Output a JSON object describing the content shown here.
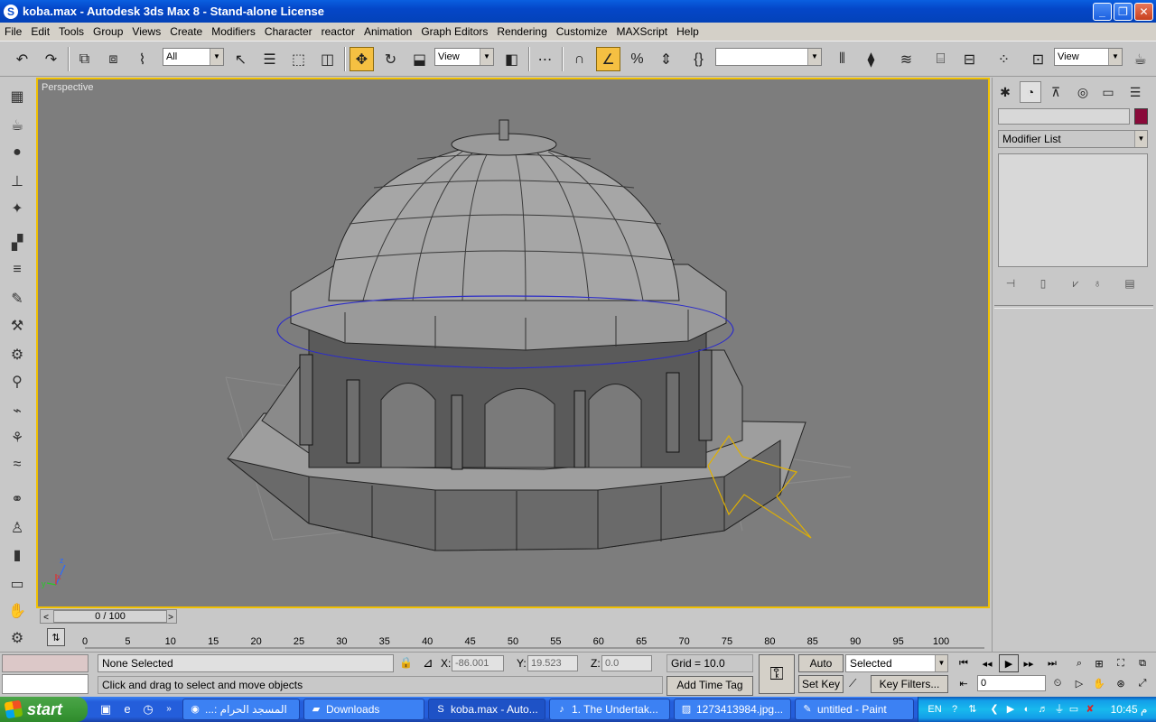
{
  "window": {
    "title": "koba.max - Autodesk 3ds Max 8  - Stand-alone License",
    "app_icon_glyph": "S",
    "controls": [
      "_",
      "❐",
      "✕"
    ]
  },
  "menu": [
    "File",
    "Edit",
    "Tools",
    "Group",
    "Views",
    "Create",
    "Modifiers",
    "Character",
    "reactor",
    "Animation",
    "Graph Editors",
    "Rendering",
    "Customize",
    "MAXScript",
    "Help"
  ],
  "toolbar": {
    "selection_filter": "All",
    "ref_coord": "View",
    "named_selection": "",
    "render_view": "View"
  },
  "viewport": {
    "label": "Perspective",
    "axis": {
      "x": "x",
      "y": "y",
      "z": "z"
    },
    "background": "#7d7d7d",
    "border_color": "#f0c000"
  },
  "command_panel": {
    "modifier_list": "Modifier List",
    "object_color": "#8a0a3a"
  },
  "time_slider": {
    "label": "0 / 100",
    "prev": "<",
    "next": ">"
  },
  "trackbar": {
    "ticks": [
      "0",
      "5",
      "10",
      "15",
      "20",
      "25",
      "30",
      "35",
      "40",
      "45",
      "50",
      "55",
      "60",
      "65",
      "70",
      "75",
      "80",
      "85",
      "90",
      "95",
      "100"
    ]
  },
  "status": {
    "selection": "None Selected",
    "prompt": "Click and drag to select and move objects",
    "x_label": "X:",
    "x_value": "-86.001",
    "y_label": "Y:",
    "y_value": "19.523",
    "z_label": "Z:",
    "z_value": "0.0",
    "grid": "Grid = 10.0",
    "add_time_tag": "Add Time Tag",
    "auto_key": "Auto Key",
    "set_key": "Set Key",
    "key_mode": "Selected",
    "key_filters": "Key Filters...",
    "frame": "0"
  },
  "taskbar": {
    "start": "start",
    "tasks": [
      {
        "label": "...: المسجد الحرام",
        "icon": "chrome-icon"
      },
      {
        "label": "Downloads",
        "icon": "folder-icon"
      },
      {
        "label": "koba.max - Auto...",
        "icon": "max-icon",
        "active": true
      },
      {
        "label": "1. The Undertak...",
        "icon": "media-icon"
      },
      {
        "label": "1273413984.jpg...",
        "icon": "image-icon"
      },
      {
        "label": "untitled - Paint",
        "icon": "paint-icon"
      }
    ],
    "lang": "EN",
    "clock": "10:45 م"
  }
}
